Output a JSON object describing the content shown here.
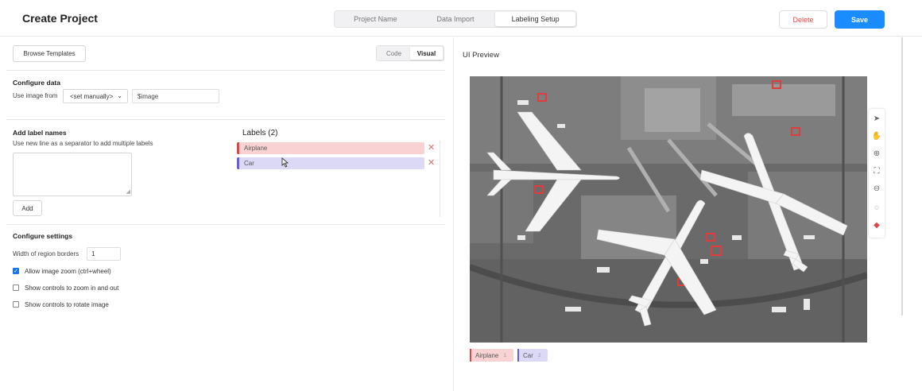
{
  "header": {
    "title": "Create Project",
    "steps": [
      "Project Name",
      "Data Import",
      "Labeling Setup"
    ],
    "active_step": "Labeling Setup",
    "delete_label": "Delete",
    "save_label": "Save",
    "save_color": "#1a8cff",
    "delete_color": "#e04646"
  },
  "left": {
    "browse_label": "Browse Templates",
    "toggle": [
      "Code",
      "Visual"
    ],
    "toggle_active": "Visual",
    "configure_data": {
      "title": "Configure data",
      "use_label": "Use image from",
      "source_value": "<set manually>",
      "variable_value": "$image"
    },
    "add_labels": {
      "title": "Add label names",
      "hint": "Use new line as a separator to add multiple labels",
      "textarea_value": "",
      "add_label": "Add"
    },
    "labels": {
      "title": "Labels (2)",
      "items": [
        {
          "name": "Airplane",
          "color": "#e04646"
        },
        {
          "name": "Car",
          "color": "#6b5cd6"
        }
      ]
    },
    "settings": {
      "title": "Configure settings",
      "border_label": "Width of region borders",
      "border_value": "1",
      "options": [
        {
          "label": "Allow image zoom (ctrl+wheel)",
          "checked": true
        },
        {
          "label": "Show controls to zoom in and out",
          "checked": false
        },
        {
          "label": "Show controls to rotate image",
          "checked": false
        }
      ]
    }
  },
  "preview": {
    "title": "UI Preview",
    "tools": [
      "pointer-icon",
      "hand-icon",
      "zoom-in-icon",
      "fit-icon",
      "zoom-out-icon",
      "brightness-icon",
      "eraser-icon"
    ],
    "legend": [
      {
        "name": "Airplane",
        "count": "1",
        "color": "#e04646"
      },
      {
        "name": "Car",
        "count": "2",
        "color": "#6b5cd6"
      }
    ]
  }
}
